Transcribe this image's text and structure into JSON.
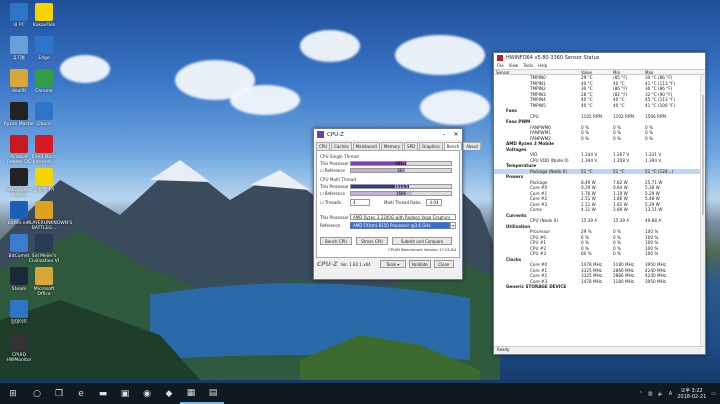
{
  "desktop": {
    "icons": [
      {
        "label": "내 PC",
        "icon": "computer-icon",
        "color": "#2e74c8"
      },
      {
        "label": "휴지통",
        "icon": "recycle-bin-icon",
        "color": "#6aa0d8"
      },
      {
        "label": "dealfit",
        "icon": "folder-icon",
        "color": "#d9a63a"
      },
      {
        "label": "Ryzen Master",
        "icon": "ryzen-icon",
        "color": "#222222"
      },
      {
        "label": "Acrobat Reader DC",
        "icon": "acrobat-icon",
        "color": "#c8191d"
      },
      {
        "label": "AMD Ryzen Master",
        "icon": "amd-icon",
        "color": "#222222"
      },
      {
        "label": "battle.net",
        "icon": "battlenet-icon",
        "color": "#1a5fb4"
      },
      {
        "label": "BitComet",
        "icon": "bitcomet-icon",
        "color": "#3b7bd0"
      },
      {
        "label": "Steam",
        "icon": "steam-icon",
        "color": "#1b2838"
      },
      {
        "label": "업데이트",
        "icon": "update-icon",
        "color": "#2e74c8"
      },
      {
        "label": "CPUID HWMonitor",
        "icon": "gauge-icon",
        "color": "#333333"
      },
      {
        "label": "KakaoTalk",
        "icon": "kakao-icon",
        "color": "#f5d400"
      },
      {
        "label": "Edge",
        "icon": "edge-icon",
        "color": "#2e74c8"
      },
      {
        "label": "Chrome",
        "icon": "chrome-icon",
        "color": "#2f9e44"
      },
      {
        "label": "Daum",
        "icon": "daum-icon",
        "color": "#2e74c8"
      },
      {
        "label": "Trend Micro Internet...",
        "icon": "trendmicro-icon",
        "color": "#d71920"
      },
      {
        "label": "곰플레이어",
        "icon": "player-icon",
        "color": "#f5d400"
      },
      {
        "label": "PLAYERUNKNOWN'S BATTLEG...",
        "icon": "pubg-icon",
        "color": "#e0a020"
      },
      {
        "label": "Sid Meier's Civilization VI",
        "icon": "civ-icon",
        "color": "#2a3a55"
      },
      {
        "label": "Microsoft Office",
        "icon": "folder-icon",
        "color": "#d9a63a"
      }
    ]
  },
  "cpuz": {
    "title": "CPU-Z",
    "tabs": [
      "CPU",
      "Caches",
      "Mainboard",
      "Memory",
      "SPD",
      "Graphics",
      "Bench",
      "About"
    ],
    "active_tab": "Bench",
    "single_thread_label": "CPU Single Thread",
    "multi_thread_label": "CPU Multi Thread",
    "this_processor": "This Processor",
    "reference": "Reference",
    "single_this": "401.3",
    "single_ref": "368",
    "multi_this": "1613.5",
    "multi_ref": "1696",
    "single_this_pct": 0.55,
    "single_ref_pct": 0.5,
    "multi_this_pct": 0.58,
    "multi_ref_pct": 0.61,
    "threads_label": "Threads",
    "threads_value": "4",
    "ratio_label": "Multi Thread Ratio",
    "ratio_value": "4.04",
    "proc_label": "This Processor",
    "proc_value": "AMD Ryzen 3 2200G with Radeon Vega Graphics",
    "ref_label": "Reference",
    "ref_value": "AMD FX(tm)-8150 Processor @3.6 GHz (4MT/8T)",
    "bench_cpu": "Bench CPU",
    "stress_cpu": "Stress CPU",
    "submit": "Submit and Compare",
    "version_note": "CPUID Benchmark Version 17.01.64",
    "brand": "CPU-Z",
    "version": "Ver. 1.82.1.x64",
    "tools": "Tools",
    "validate": "Validate",
    "close": "Close"
  },
  "hwinfo": {
    "title": "HWiNFO64 v5.80-3360 Sensor Status",
    "menu": [
      "File",
      "View",
      "Tools",
      "Help"
    ],
    "columns": [
      "Sensor",
      "Value",
      "Min",
      "Max"
    ],
    "rows": [
      {
        "s": "TMPIN0",
        "v": "29 °C",
        "mi": "(85 °F)",
        "ma": "30 °C (86 °F)",
        "type": "item"
      },
      {
        "s": "TMPIN1",
        "v": "40 °C",
        "mi": "40 °C",
        "ma": "41 °C (113 °F)",
        "type": "item"
      },
      {
        "s": "TMPIN2",
        "v": "30 °C",
        "mi": "(86 °F)",
        "ma": "30 °C (86 °F)",
        "type": "item"
      },
      {
        "s": "TMPIN3",
        "v": "28 °C",
        "mi": "(82 °F)",
        "ma": "32 °C (90 °F)",
        "type": "item"
      },
      {
        "s": "TMPIN4",
        "v": "40 °C",
        "mi": "40 °C",
        "ma": "45 °C (113 °F)",
        "type": "item"
      },
      {
        "s": "TMPIN5",
        "v": "40 °C",
        "mi": "40 °C",
        "ma": "41 °C (106 °F)",
        "type": "item"
      },
      {
        "s": "Fans",
        "v": "",
        "mi": "",
        "ma": "",
        "type": "group"
      },
      {
        "s": "CPU",
        "v": "1105 RPM",
        "mi": "1102 RPM",
        "ma": "1506 RPM",
        "type": "item"
      },
      {
        "s": "Fans PWM",
        "v": "",
        "mi": "",
        "ma": "",
        "type": "group"
      },
      {
        "s": "FANPWM0",
        "v": "0 %",
        "mi": "0 %",
        "ma": "0 %",
        "type": "item"
      },
      {
        "s": "FANPWM1",
        "v": "0 %",
        "mi": "0 %",
        "ma": "0 %",
        "type": "item"
      },
      {
        "s": "FANPWM2",
        "v": "0 %",
        "mi": "0 %",
        "ma": "0 %",
        "type": "item"
      },
      {
        "s": "AMD Ryzen 3 Mobile",
        "v": "",
        "mi": "",
        "ma": "",
        "type": "group"
      },
      {
        "s": "Voltages",
        "v": "",
        "mi": "",
        "ma": "",
        "type": "group"
      },
      {
        "s": "VID",
        "v": "1.244 V",
        "mi": "1.267 V",
        "ma": "1.331 V",
        "type": "item"
      },
      {
        "s": "CPU VDD (Node 0)",
        "v": "1.394 V",
        "mi": "1.208 V",
        "ma": "1.394 V",
        "type": "item"
      },
      {
        "s": "Temperature",
        "v": "",
        "mi": "",
        "ma": "",
        "type": "group"
      },
      {
        "s": "Package (Node 0)",
        "v": "51 °C",
        "mi": "51 °C",
        "ma": "51 °C (124...)",
        "type": "highlight"
      },
      {
        "s": "Powers",
        "v": "",
        "mi": "",
        "ma": "",
        "type": "group"
      },
      {
        "s": "Package",
        "v": "8.49 W",
        "mi": "7.82 W",
        "ma": "25.71 W",
        "type": "item"
      },
      {
        "s": "Core #0",
        "v": "0.29 W",
        "mi": "0.84 W",
        "ma": "5.28 W",
        "type": "item"
      },
      {
        "s": "Core #1",
        "v": "1.76 W",
        "mi": "1.19 W",
        "ma": "5.29 W",
        "type": "item"
      },
      {
        "s": "Core #2",
        "v": "2.51 W",
        "mi": "1.86 W",
        "ma": "5.48 W",
        "type": "item"
      },
      {
        "s": "Core #3",
        "v": "2.11 W",
        "mi": "1.81 W",
        "ma": "5.29 W",
        "type": "item"
      },
      {
        "s": "Cores",
        "v": "4.11 W",
        "mi": "3.89 W",
        "ma": "13.11 W",
        "type": "item"
      },
      {
        "s": "Currents",
        "v": "",
        "mi": "",
        "ma": "",
        "type": "group"
      },
      {
        "s": "CPU (Node 0)",
        "v": "15.39 A",
        "mi": "15.39 A",
        "ma": "49.88 A",
        "type": "item"
      },
      {
        "s": "Utilization",
        "v": "",
        "mi": "",
        "ma": "",
        "type": "group"
      },
      {
        "s": "Processor",
        "v": "29 %",
        "mi": "0 %",
        "ma": "100 %",
        "type": "item"
      },
      {
        "s": "CPU #0",
        "v": "6 %",
        "mi": "0 %",
        "ma": "100 %",
        "type": "item"
      },
      {
        "s": "CPU #1",
        "v": "0 %",
        "mi": "0 %",
        "ma": "100 %",
        "type": "item"
      },
      {
        "s": "CPU #2",
        "v": "0 %",
        "mi": "0 %",
        "ma": "100 %",
        "type": "item"
      },
      {
        "s": "CPU #3",
        "v": "60 %",
        "mi": "0 %",
        "ma": "100 %",
        "type": "item"
      },
      {
        "s": "Clocks",
        "v": "",
        "mi": "",
        "ma": "",
        "type": "group"
      },
      {
        "s": "Core #0",
        "v": "1478 MHz",
        "mi": "1180 MHz",
        "ma": "3950 MHz",
        "type": "item"
      },
      {
        "s": "Core #1",
        "v": "3325 MHz",
        "mi": "2866 MHz",
        "ma": "4240 MHz",
        "type": "item"
      },
      {
        "s": "Core #2",
        "v": "3325 MHz",
        "mi": "2866 MHz",
        "ma": "4240 MHz",
        "type": "item"
      },
      {
        "s": "Core #3",
        "v": "1478 MHz",
        "mi": "1180 MHz",
        "ma": "3950 MHz",
        "type": "item"
      },
      {
        "s": "Generic STORAGE DEVICE",
        "v": "",
        "mi": "",
        "ma": "",
        "type": "group"
      }
    ],
    "status": "Ready"
  },
  "taskbar": {
    "items": [
      {
        "icon": "windows-start-icon",
        "glyph": "⊞"
      },
      {
        "icon": "search-icon",
        "glyph": "○"
      },
      {
        "icon": "task-view-icon",
        "glyph": "❐"
      },
      {
        "icon": "edge-icon",
        "glyph": "e"
      },
      {
        "icon": "file-explorer-icon",
        "glyph": "▬"
      },
      {
        "icon": "store-icon",
        "glyph": "▣"
      },
      {
        "icon": "chrome-icon",
        "glyph": "◉"
      },
      {
        "icon": "kakao-icon",
        "glyph": "◆"
      },
      {
        "icon": "cpuz-icon",
        "glyph": "▦"
      },
      {
        "icon": "hwinfo-icon",
        "glyph": "▤"
      }
    ],
    "time": "오후 3:22",
    "date": "2018-02-21",
    "lang": "A"
  }
}
